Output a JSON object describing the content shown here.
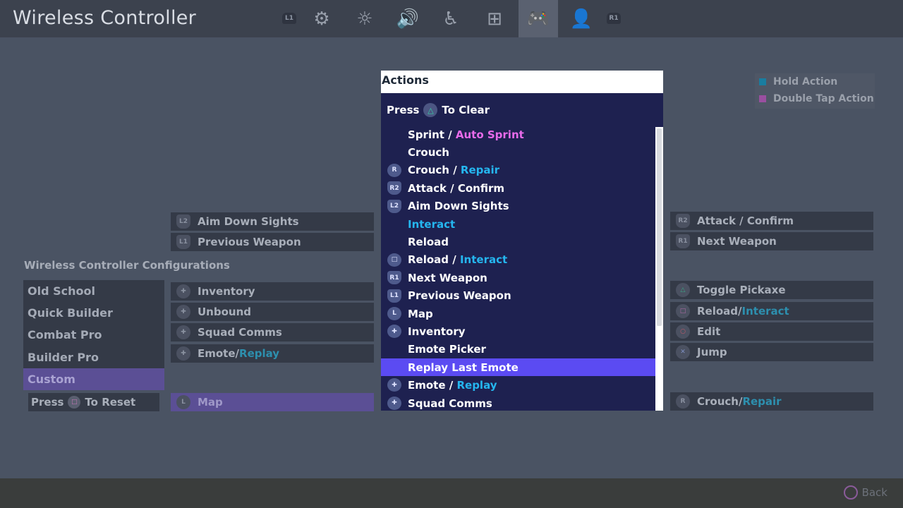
{
  "window": {
    "title": "Wireless Controller"
  },
  "tabs": [
    {
      "name": "l1-bumper",
      "glyph": "L1"
    },
    {
      "name": "gear-icon",
      "glyph": "⚙"
    },
    {
      "name": "brightness-icon",
      "glyph": "☼"
    },
    {
      "name": "speaker-icon",
      "glyph": "🔊"
    },
    {
      "name": "accessibility-icon",
      "glyph": "♿"
    },
    {
      "name": "network-icon",
      "glyph": "⊞"
    },
    {
      "name": "gamepad-icon",
      "glyph": "🎮"
    },
    {
      "name": "account-icon",
      "glyph": "👤"
    },
    {
      "name": "r1-bumper",
      "glyph": "R1"
    }
  ],
  "legend": {
    "hold_label": "Hold Action",
    "hold_color": "#1a7da0",
    "double_label": "Double Tap Action",
    "double_color": "#9a4fa0"
  },
  "left_bindings": {
    "l2": {
      "button": "L2",
      "label": "Aim Down Sights"
    },
    "l1": {
      "button": "L1",
      "label": "Previous Weapon"
    },
    "dpad_up": {
      "label": "Inventory"
    },
    "dpad_right": {
      "label": "Unbound"
    },
    "dpad_down": {
      "label": "Squad Comms"
    },
    "dpad_left": {
      "label": "Emote",
      "sep": " / ",
      "hold": "Replay"
    },
    "l3": {
      "button": "L",
      "label": "Map"
    }
  },
  "right_bindings": {
    "r2": {
      "button": "R2",
      "label": "Attack / Confirm"
    },
    "r1": {
      "button": "R1",
      "label": "Next Weapon"
    },
    "triangle": {
      "button": "△",
      "label": "Toggle Pickaxe"
    },
    "square": {
      "button": "□",
      "label": "Reload",
      "sep": " / ",
      "hold": "Interact"
    },
    "circle": {
      "button": "○",
      "label": "Edit"
    },
    "cross": {
      "button": "✕",
      "label": "Jump"
    },
    "r3": {
      "button": "R",
      "label": "Crouch",
      "sep": " / ",
      "hold": "Repair"
    }
  },
  "configurations": {
    "heading": "Wireless Controller Configurations",
    "items": [
      "Old School",
      "Quick Builder",
      "Combat Pro",
      "Builder Pro",
      "Custom"
    ],
    "selected": "Custom",
    "reset_press": "Press",
    "reset_button": "□",
    "reset_action": "To Reset"
  },
  "actions_popup": {
    "title": "Actions",
    "clear_press": "Press",
    "clear_button": "△",
    "clear_action": "To Clear",
    "items": [
      {
        "icon": "",
        "main": "Sprint",
        "sep": " / ",
        "double": "Auto Sprint"
      },
      {
        "icon": "",
        "main": "Crouch"
      },
      {
        "icon": "R",
        "main": "Crouch",
        "sep": " / ",
        "hold": "Repair"
      },
      {
        "icon": "R2",
        "main": "Attack / Confirm"
      },
      {
        "icon": "L2",
        "main": "Aim Down Sights"
      },
      {
        "icon": "",
        "hold": "Interact"
      },
      {
        "icon": "",
        "main": "Reload"
      },
      {
        "icon": "□",
        "main": "Reload",
        "sep": " / ",
        "hold": "Interact"
      },
      {
        "icon": "R1",
        "main": "Next Weapon"
      },
      {
        "icon": "L1",
        "main": "Previous Weapon"
      },
      {
        "icon": "L",
        "main": "Map"
      },
      {
        "icon": "✚",
        "main": "Inventory"
      },
      {
        "icon": "",
        "main": "Emote Picker"
      },
      {
        "icon": "",
        "main": "Replay Last Emote",
        "highlight": true
      },
      {
        "icon": "✚",
        "main": "Emote",
        "sep": " / ",
        "hold": "Replay"
      },
      {
        "icon": "✚",
        "main": "Squad Comms"
      }
    ]
  },
  "footer": {
    "back_label": "Back"
  }
}
